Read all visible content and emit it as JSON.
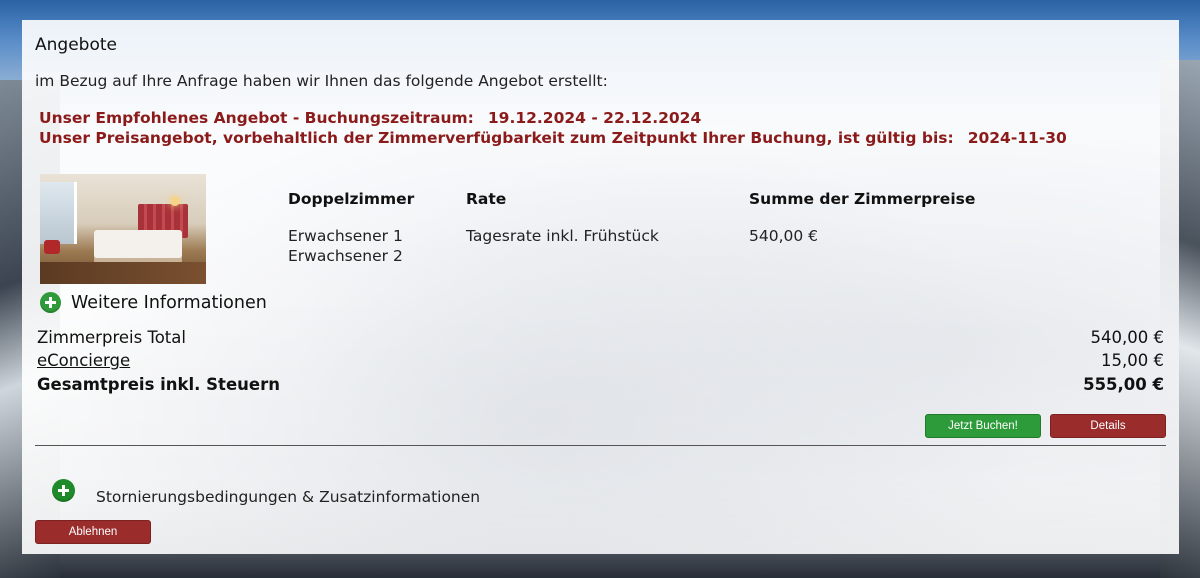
{
  "page": {
    "heading": "Angebote",
    "intro": "im Bezug auf Ihre Anfrage haben wir Ihnen das folgende Angebot erstellt:"
  },
  "offer": {
    "line1_label": "Unser Empfohlenes Angebot - Buchungszeitraum:",
    "line1_value": "19.12.2024 - 22.12.2024",
    "line2_label": "Unser Preisangebot, vorbehaltlich der Zimmerverfügbarkeit zum Zeitpunkt Ihrer Buchung, ist gültig bis:",
    "line2_value": "2024-11-30"
  },
  "room": {
    "headers": {
      "room": "Doppelzimmer",
      "rate": "Rate",
      "total": "Summe der Zimmerpreise"
    },
    "guests": [
      "Erwachsener 1",
      "Erwachsener 2"
    ],
    "rate": "Tagesrate inkl. Frühstück",
    "total": "540,00 €",
    "more_info": "Weitere Informationen"
  },
  "summary": {
    "room_total_label": "Zimmerpreis Total",
    "room_total_value": "540,00 €",
    "concierge_label": "eConcierge",
    "concierge_value": "15,00 €",
    "grand_total_label": "Gesamtpreis inkl. Steuern",
    "grand_total_value": "555,00 €"
  },
  "buttons": {
    "book": "Jetzt Buchen!",
    "details": "Details",
    "decline": "Ablehnen"
  },
  "cancellation": {
    "label": "Stornierungsbedingungen & Zusatzinformationen"
  },
  "colors": {
    "accent_red": "#8b1a1a",
    "button_green": "#2e9b3a",
    "button_red": "#9b2c2c"
  }
}
